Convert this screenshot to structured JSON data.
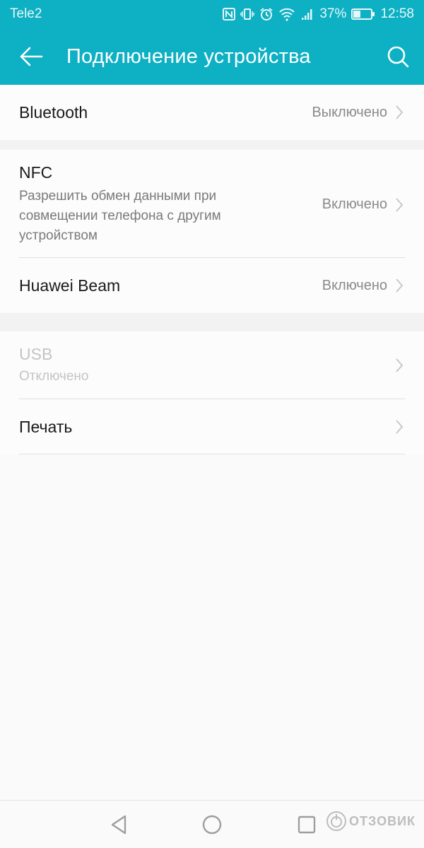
{
  "status_bar": {
    "carrier": "Tele2",
    "icons": [
      "nfc-icon",
      "vibrate-icon",
      "alarm-icon",
      "wifi-icon",
      "signal-icon",
      "battery-icon"
    ],
    "battery_percent": "37%",
    "time": "12:58"
  },
  "app_bar": {
    "title": "Подключение устройства",
    "back_icon": "arrow-left-icon",
    "search_icon": "search-icon",
    "color": "#0eb0c4"
  },
  "settings": {
    "bluetooth": {
      "label": "Bluetooth",
      "value": "Выключено"
    },
    "nfc": {
      "label": "NFC",
      "description": "Разрешить обмен данными при совмещении телефона с другим устройством",
      "value": "Включено"
    },
    "huawei_beam": {
      "label": "Huawei Beam",
      "value": "Включено"
    },
    "usb": {
      "label": "USB",
      "description": "Отключено",
      "disabled": true
    },
    "print": {
      "label": "Печать"
    }
  },
  "nav_bar": {
    "back": "nav-back-icon",
    "home": "nav-home-icon",
    "recents": "nav-recents-icon"
  },
  "watermark": {
    "text": "ОТЗОВИК"
  }
}
